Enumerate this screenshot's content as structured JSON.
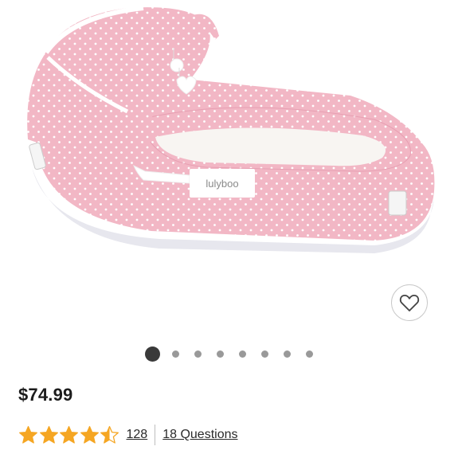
{
  "product": {
    "image_alt": "Pink polka dot baby bassinet",
    "logo_text": "lulyboo",
    "price": "$74.99",
    "rating": 4.5,
    "reviews_count": "128",
    "questions_label": "18 Questions"
  },
  "carousel": {
    "total_slides": 8,
    "active_index": 0
  },
  "colors": {
    "pink": "#f2b7c5",
    "pink_dark": "#e79fb2",
    "star": "#f5a623",
    "text": "#1c1c1c"
  },
  "icons": {
    "wishlist": "heart-icon",
    "star": "star-icon"
  }
}
